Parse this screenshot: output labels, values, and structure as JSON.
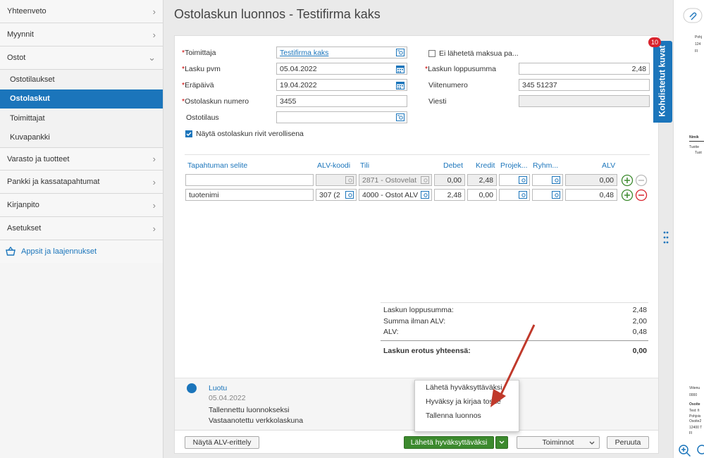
{
  "sidebar": {
    "items": [
      {
        "label": "Yhteenveto"
      },
      {
        "label": "Myynnit"
      },
      {
        "label": "Ostot"
      }
    ],
    "sub": [
      "Ostotilaukset",
      "Ostolaskut",
      "Toimittajat",
      "Kuvapankki"
    ],
    "items2": [
      {
        "label": "Varasto ja tuotteet"
      },
      {
        "label": "Pankki ja kassatapahtumat"
      },
      {
        "label": "Kirjanpito"
      },
      {
        "label": "Asetukset"
      }
    ],
    "apps": "Appsit ja laajennukset"
  },
  "page": {
    "title": "Ostolaskun luonnos - Testifirma kaks"
  },
  "form": {
    "supplier_label": "Toimittaja",
    "supplier_value": "Testifirma kaks",
    "date_label": "Lasku pvm",
    "date_value": "05.04.2022",
    "due_label": "Eräpäivä",
    "due_value": "19.04.2022",
    "number_label": "Ostolaskun numero",
    "number_value": "3455",
    "order_label": "Ostotilaus",
    "order_value": "",
    "no_pay_label": "Ei lähetetä maksua pa...",
    "total_label": "Laskun loppusumma",
    "total_value": "2,48",
    "ref_label": "Viitenumero",
    "ref_value": "345 51237",
    "msg_label": "Viesti",
    "msg_value": "",
    "vat_rows_label": "Näytä ostolaskun rivit verollisena"
  },
  "table": {
    "headers": [
      "Tapahtuman selite",
      "ALV-koodi",
      "Tili",
      "Debet",
      "Kredit",
      "Projek...",
      "Ryhm...",
      "ALV"
    ],
    "rows": [
      {
        "desc": "",
        "vat": "",
        "account": "2871 - Ostovelat",
        "debit": "0,00",
        "credit": "2,48",
        "vatsum": "0,00"
      },
      {
        "desc": "tuotenimi",
        "vat": "307 (2",
        "account": "4000 - Ostot ALV",
        "debit": "2,48",
        "credit": "0,00",
        "vatsum": "0,48"
      }
    ]
  },
  "summary": {
    "total_label": "Laskun loppusumma:",
    "total": "2,48",
    "net_label": "Summa ilman ALV:",
    "net": "2,00",
    "vat_label": "ALV:",
    "vat": "0,48",
    "diff_label": "Laskun erotus yhteensä:",
    "diff": "0,00"
  },
  "history": {
    "status": "Luotu",
    "date": "05.04.2022",
    "line1": "Tallennettu luonnokseksi",
    "line2": "Vastaanotettu verkkolaskuna"
  },
  "dropdown": [
    "Lähetä hyväksyttäväksi",
    "Hyväksy ja kirjaa tosite",
    "Tallenna luonnos"
  ],
  "buttons": {
    "vat_breakdown": "Näytä ALV-erittely",
    "send": "Lähetä hyväksyttäväksi",
    "actions": "Toiminnot",
    "cancel": "Peruuta"
  },
  "side_tab": {
    "label": "Kohdistetut kuvat",
    "count": "10"
  },
  "preview": {
    "t1": "Pohj",
    "t2": "124",
    "t3": "FI",
    "t4": "Nimik",
    "t5": "Tuotte",
    "t6": "Tuot",
    "t7": "Viitenu",
    "t8": "0000",
    "t9": "Osoite",
    "t10": "Test: fi",
    "t11": "Pohjois",
    "t12": "Osoite2",
    "t13": "12400 T",
    "t14": "FI"
  },
  "colors": {
    "accent": "#1b75bb",
    "green": "#3c8a2e",
    "red": "#d9232d"
  }
}
